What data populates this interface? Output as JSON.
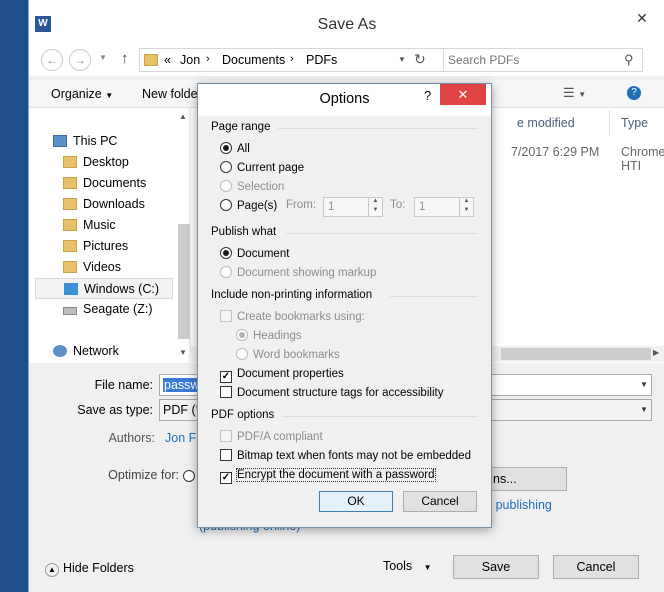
{
  "window": {
    "title": "Save As",
    "app_icon": "W"
  },
  "address": {
    "path": [
      "«",
      "Jon",
      "Documents",
      "PDFs"
    ],
    "search_placeholder": "Search PDFs"
  },
  "toolbar": {
    "organize": "Organize",
    "new_folder": "New folder"
  },
  "nav": {
    "items": [
      {
        "label": "This PC",
        "icon": "computer-icon"
      },
      {
        "label": "Desktop",
        "icon": "folder-icon"
      },
      {
        "label": "Documents",
        "icon": "folder-icon"
      },
      {
        "label": "Downloads",
        "icon": "folder-icon"
      },
      {
        "label": "Music",
        "icon": "folder-icon"
      },
      {
        "label": "Pictures",
        "icon": "folder-icon"
      },
      {
        "label": "Videos",
        "icon": "folder-icon"
      },
      {
        "label": "Windows (C:)",
        "icon": "drive-icon"
      },
      {
        "label": "Seagate (Z:)",
        "icon": "drive-icon"
      },
      {
        "label": "Network",
        "icon": "network-icon"
      }
    ]
  },
  "files": {
    "columns": [
      "e modified",
      "Type"
    ],
    "rows": [
      {
        "modified": "7/2017 6:29 PM",
        "type": "Chrome HTI"
      }
    ]
  },
  "form": {
    "file_name_label": "File name:",
    "file_name_value": "passw",
    "save_type_label": "Save as type:",
    "save_type_value": "PDF (*.",
    "authors_label": "Authors:",
    "authors_value": "Jon Fis",
    "optimize_label": "Optimize for:",
    "publishing_note": "(publishing online)",
    "options_button_partial": "ns...",
    "after_publishing": "er publishing"
  },
  "footer": {
    "hide_folders": "Hide Folders",
    "tools": "Tools",
    "save": "Save",
    "cancel": "Cancel"
  },
  "options_dialog": {
    "title": "Options",
    "help": "?",
    "page_range": {
      "heading": "Page range",
      "all": "All",
      "current_page": "Current page",
      "selection": "Selection",
      "pages": "Page(s)",
      "from_label": "From:",
      "from_value": "1",
      "to_label": "To:",
      "to_value": "1"
    },
    "publish_what": {
      "heading": "Publish what",
      "document": "Document",
      "document_markup": "Document showing markup"
    },
    "non_printing": {
      "heading": "Include non-printing information",
      "create_bookmarks": "Create bookmarks using:",
      "headings": "Headings",
      "word_bookmarks": "Word bookmarks",
      "document_properties": "Document properties",
      "structure_tags": "Document structure tags for accessibility"
    },
    "pdf_options": {
      "heading": "PDF options",
      "pdfa": "PDF/A compliant",
      "bitmap_text": "Bitmap text when fonts may not be embedded",
      "encrypt": "Encrypt the document with a password"
    },
    "ok": "OK",
    "cancel": "Cancel"
  },
  "colors": {
    "accent_blue": "#1e6fb8",
    "close_red": "#e04343",
    "desktop_blue": "#1e4e8c"
  }
}
